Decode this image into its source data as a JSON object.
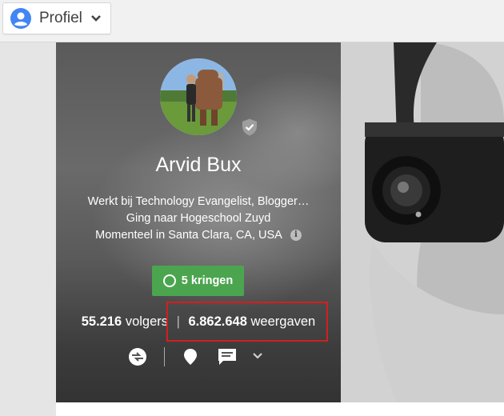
{
  "header": {
    "profile_menu_label": "Profiel"
  },
  "profile": {
    "name": "Arvid Bux",
    "about_lines": [
      "Werkt bij Technology Evangelist, Blogger…",
      "Ging naar Hogeschool Zuyd",
      "Momenteel in Santa Clara, CA, USA"
    ],
    "circles_button": "5 kringen",
    "followers_count": "55.216",
    "followers_label": "volgers",
    "separator": "|",
    "views_count": "6.862.648",
    "views_label": "weergaven"
  },
  "icons": {
    "profile_menu": "account-circle-icon",
    "verified": "verified-shield-icon",
    "info": "info-icon",
    "share": "share-link-icon",
    "pin": "location-pin-icon",
    "message": "message-icon",
    "more": "chevron-down-icon"
  },
  "colors": {
    "accent_blue": "#4285f4",
    "circles_green": "#4ba54f",
    "highlight_red": "#d41f1f"
  }
}
